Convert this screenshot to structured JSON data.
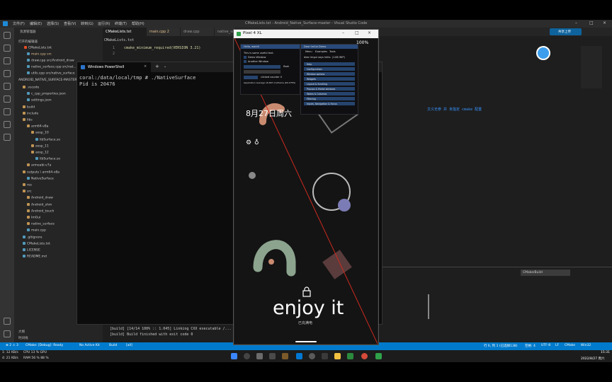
{
  "vscode": {
    "menu": [
      "文件(F)",
      "编辑(E)",
      "选择(S)",
      "查看(V)",
      "转到(G)",
      "运行(R)",
      "终端(T)",
      "帮助(H)"
    ],
    "window_title": "CMakeLists.txt - Android_Native_Surface-master - Visual Studio Code",
    "share_button": "共享上传",
    "activity_icons": [
      "explorer-icon",
      "search-icon",
      "source-control-icon",
      "run-debug-icon",
      "extensions-icon",
      "remote-icon",
      "test-icon",
      "cmake-icon",
      "docker-icon",
      "account-icon",
      "gear-icon"
    ],
    "sidebar": {
      "header": "资源管理器",
      "open_editors": "打开的编辑器",
      "open_files": [
        "CMakeLists.txt",
        "main.cpp src",
        "draw.cpp src/Android_draw",
        "native_surface.cpp src/nat...",
        "utils.cpp src/native_surface"
      ],
      "project": "ANDROID_NATIVE_SURFACE-MASTER",
      "tree": [
        ".vscode",
        "c_cpp_properties.json",
        "settings.json",
        "build",
        "include",
        "libs",
        "arm64-v8a",
        "aosp_10",
        "libSurface.so",
        "aosp_11",
        "aosp_12",
        "libSurface.so",
        "armeabi-v7a",
        "outputs \\ arm64-v8a",
        "NativeSurface",
        "res",
        "src",
        "Android_draw",
        "Android_shm",
        "Android_touch",
        "ImGui",
        "native_surface",
        "main.cpp",
        ".gitignore",
        "CMakeLists.txt",
        "LICENSE",
        "README.md"
      ],
      "outline": "大纲",
      "timeline": "时间线"
    },
    "tabs": [
      "CMakeLists.txt",
      "main.cpp 2",
      "draw.cpp",
      "native_surface.cpp",
      "utils.cpp"
    ],
    "breadcrumb": "CMakeLists.txt",
    "code_lines": [
      {
        "n": "1",
        "text": "cmake_minimum_required(VERSION 3.21)"
      },
      {
        "n": "2",
        "text": ""
      }
    ],
    "code_hint": "文义无参 并 未指定 cmake 配置",
    "panel_select": "CMake/Build",
    "build_lines": [
      "[build] [14/14 100% :: 1.045] Linking CXX executable /...",
      "[build] Build finished with exit code 0"
    ],
    "status": {
      "left": [
        "⊗ 2 ⚠ 3",
        "CMake: [Debug]: Ready",
        "No Active Kit",
        "Build",
        "[all]"
      ],
      "right": [
        "行 6, 列 1 (已选择138)",
        "空格: 4",
        "UTF-8",
        "LF",
        "CMake",
        "Win32"
      ]
    }
  },
  "powershell": {
    "tab_title": "Windows PowerShell",
    "lines": [
      "coral:/data/local/tmp # ./NativeSurface",
      "Pid is 20476"
    ]
  },
  "phone": {
    "window_title": "Pixel 4 XL",
    "zoom": "100%",
    "date": "8月27日周六",
    "enjoy": "enjoy it",
    "unlock_hint": "已充满电",
    "imgui_main": {
      "title": "Hello, world!",
      "lines": [
        "This is some useful text.",
        "Demo Window",
        "Another Window",
        "float",
        "clicked counter 0",
        "Application average 16.667 ms/frame (60.0 FPS)"
      ]
    },
    "imgui_demo": {
      "title": "Dear ImGui Demo",
      "header": "dear imgui says hello. (1.88 WIP)",
      "menu": [
        "Menu",
        "Examples",
        "Tools"
      ],
      "items": [
        "Help",
        "Configuration",
        "Window options",
        "Widgets",
        "Layout & Scrolling",
        "Popups & Modal windows",
        "Tables & Columns",
        "Filtering",
        "Inputs, Navigation & Focus"
      ]
    }
  },
  "taskbar": {
    "left_top": "1: 12 KB/s",
    "left_bottom": "4: 21 KB/s",
    "cpu": "CPU 13 % GPU",
    "mem": "RAM 56 % 88 %",
    "time": "15:31",
    "date": "2022/8/27 周六"
  },
  "colors": {
    "accent": "#007acc",
    "editor_bg": "#1e1e1e",
    "sidebar_bg": "#252526"
  }
}
